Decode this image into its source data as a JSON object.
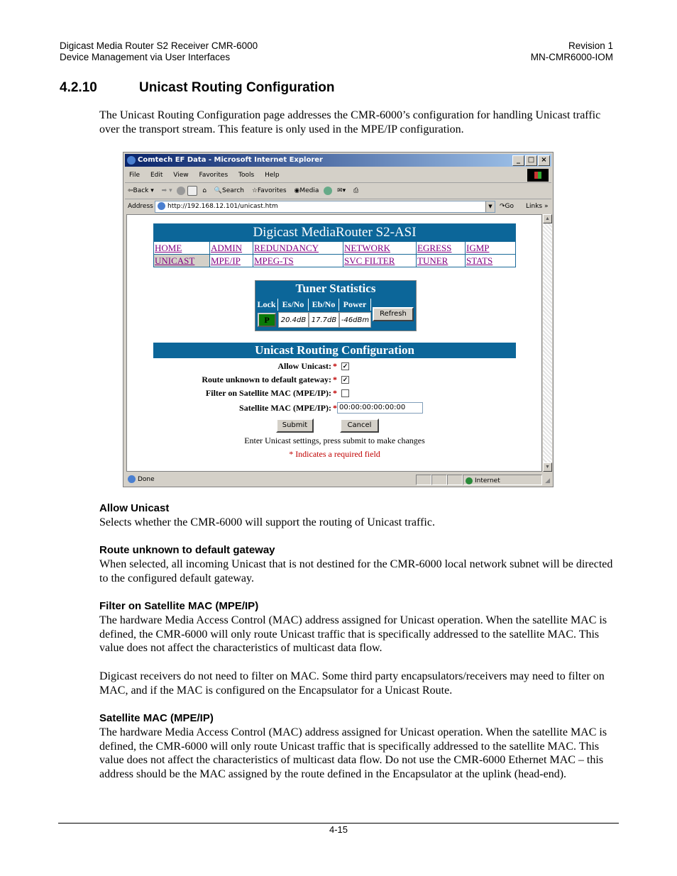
{
  "doc_header": {
    "left_line1": "Digicast Media Router S2 Receiver CMR-6000",
    "left_line2": "Device Management via User Interfaces",
    "right_line1": "Revision 1",
    "right_line2": "MN-CMR6000-IOM"
  },
  "section": {
    "number": "4.2.10",
    "title": "Unicast Routing Configuration",
    "intro": "The Unicast Routing Configuration page addresses the CMR-6000’s configuration for handling Unicast traffic over the transport stream.  This feature is only used in the MPE/IP configuration."
  },
  "browser": {
    "window_title": "Comtech EF Data - Microsoft Internet Explorer",
    "window_buttons": [
      "_",
      "□",
      "×"
    ],
    "menu": [
      "File",
      "Edit",
      "View",
      "Favorites",
      "Tools",
      "Help"
    ],
    "toolbar": {
      "back": "Back",
      "search": "Search",
      "favorites": "Favorites",
      "media": "Media"
    },
    "address_label": "Address",
    "address_value": "http://192.168.12.101/unicast.htm",
    "go_label": "Go",
    "links_label": "Links",
    "status_text": "Done",
    "zone_text": "Internet",
    "page": {
      "banner_title": "Digicast MediaRouter S2-ASI",
      "nav_rows": [
        [
          "HOME",
          "ADMIN",
          "REDUNDANCY",
          "NETWORK",
          "EGRESS",
          "IGMP"
        ],
        [
          "UNICAST",
          "MPE/IP",
          "MPEG-TS",
          "SVC FILTER",
          "TUNER",
          "STATS"
        ]
      ],
      "active_nav": "UNICAST",
      "tuner": {
        "title": "Tuner Statistics",
        "columns": [
          "Lock",
          "Es/No",
          "Eb/No",
          "Power"
        ],
        "lock_value": "P",
        "esno": "20.4dB",
        "ebno": "17.7dB",
        "power": "-46dBm",
        "refresh_label": "Refresh"
      },
      "form": {
        "title": "Unicast Routing Configuration",
        "fields": [
          {
            "label": "Allow Unicast:",
            "type": "checkbox",
            "checked": true
          },
          {
            "label": "Route unknown to default gateway:",
            "type": "checkbox",
            "checked": true
          },
          {
            "label": "Filter on Satellite MAC (MPE/IP):",
            "type": "checkbox",
            "checked": false
          },
          {
            "label": "Satellite MAC (MPE/IP):",
            "type": "text",
            "value": "00:00:00:00:00:00"
          }
        ],
        "required_marker": "*",
        "submit_label": "Submit",
        "cancel_label": "Cancel",
        "instructions": "Enter Unicast settings, press submit to make changes",
        "required_note": "* Indicates a required field"
      }
    }
  },
  "descriptions": [
    {
      "heading": "Allow Unicast",
      "paragraphs": [
        "Selects whether the CMR-6000 will support the routing of Unicast traffic."
      ]
    },
    {
      "heading": "Route unknown to default gateway",
      "paragraphs": [
        "When selected, all incoming Unicast that is not destined for the CMR-6000 local network subnet will be directed to the configured default gateway."
      ]
    },
    {
      "heading": "Filter on Satellite MAC (MPE/IP)",
      "paragraphs": [
        "The hardware Media Access Control (MAC) address assigned for Unicast operation. When the satellite MAC is defined, the CMR-6000 will only route Unicast traffic that is specifically addressed to the satellite MAC. This value does not affect the characteristics of multicast data flow.",
        "Digicast receivers do not need to filter on MAC. Some third party encapsulators/receivers may need to filter on MAC, and if the MAC is configured on the Encapsulator for a Unicast Route."
      ]
    },
    {
      "heading": "Satellite MAC (MPE/IP)",
      "paragraphs": [
        "The hardware Media Access Control (MAC) address assigned for Unicast operation. When the satellite MAC is defined, the CMR-6000 will only route Unicast traffic that is specifically addressed to the satellite MAC. This value does not affect the characteristics of multicast data flow.  Do not use the CMR-6000 Ethernet MAC – this address should be the MAC assigned by the route defined in the Encapsulator at the uplink (head-end)."
      ]
    }
  ],
  "footer": {
    "page_number": "4-15"
  },
  "colors": {
    "banner_blue": "#0c6699",
    "link_purple": "#800080",
    "required_red": "#c00000",
    "lock_green": "#0a7a0a"
  }
}
